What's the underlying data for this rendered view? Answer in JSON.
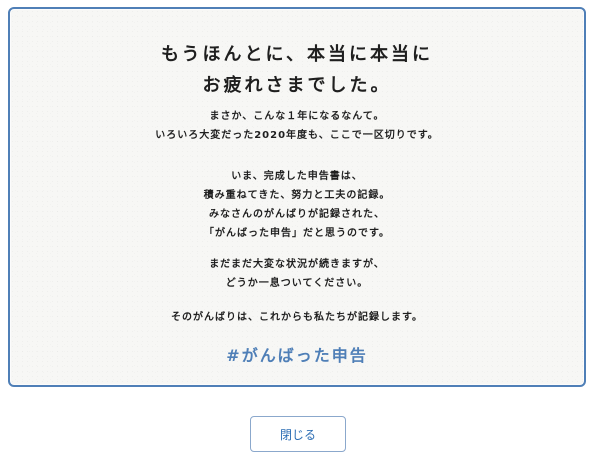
{
  "message": {
    "headline": [
      "もうほんとに、本当に本当に",
      "お疲れさまでした。"
    ],
    "paragraph_1": [
      "まさか、こんな１年になるなんて。",
      "いろいろ大変だった2020年度も、ここで一区切りです。"
    ],
    "paragraph_2": [
      "いま、完成した申告書は、",
      "積み重ねてきた、努力と工夫の記録。",
      "みなさんのがんばりが記録された、",
      "「がんばった申告」だと思うのです。"
    ],
    "paragraph_3": [
      "まだまだ大変な状況が続きますが、",
      "どうか一息ついてください。"
    ],
    "paragraph_4": [
      "そのがんばりは、これからも私たちが記録します。"
    ],
    "hashtag": "#がんばった申告"
  },
  "footer": {
    "close_label": "閉じる"
  },
  "colors": {
    "accent": "#4f7fb7",
    "button_text": "#2b6db4",
    "card_bg": "#f7f7f5"
  }
}
